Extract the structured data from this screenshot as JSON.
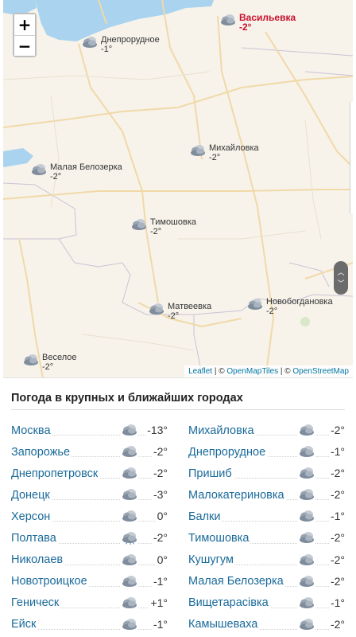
{
  "map": {
    "zoom_in": "+",
    "zoom_out": "−",
    "markers": [
      {
        "name": "Васильевка",
        "temp": "-2°",
        "icon": "cloud-icon",
        "active": true
      },
      {
        "name": "Днепрорудное",
        "temp": "-1°",
        "icon": "cloud-icon",
        "active": false
      },
      {
        "name": "Михайловка",
        "temp": "-2°",
        "icon": "cloud-icon",
        "active": false
      },
      {
        "name": "Малая Белозерка",
        "temp": "-2°",
        "icon": "cloud-icon",
        "active": false
      },
      {
        "name": "Тимошовка",
        "temp": "-2°",
        "icon": "cloud-icon",
        "active": false
      },
      {
        "name": "Новобогдановка",
        "temp": "-2°",
        "icon": "cloud-icon",
        "active": false
      },
      {
        "name": "Матвеевка",
        "temp": "-2°",
        "icon": "cloud-icon",
        "active": false
      },
      {
        "name": "Веселое",
        "temp": "-2°",
        "icon": "cloud-icon",
        "active": false
      }
    ],
    "attribution": {
      "leaflet": "Leaflet",
      "sep1": " | © ",
      "openmaptiles": "OpenMapTiles",
      "sep2": " | © ",
      "openstreetmap": "OpenStreetMap"
    }
  },
  "cities": {
    "title": "Погода в крупных и ближайших городах",
    "left": [
      {
        "name": "Москва",
        "temp": "-13°",
        "icon": "cloud-icon"
      },
      {
        "name": "Запорожье",
        "temp": "-2°",
        "icon": "cloud-icon"
      },
      {
        "name": "Днепропетровск",
        "temp": "-2°",
        "icon": "cloud-icon"
      },
      {
        "name": "Донецк",
        "temp": "-3°",
        "icon": "cloud-icon"
      },
      {
        "name": "Херсон",
        "temp": "0°",
        "icon": "cloud-icon"
      },
      {
        "name": "Полтава",
        "temp": "-2°",
        "icon": "snow-cloud-icon"
      },
      {
        "name": "Николаев",
        "temp": "0°",
        "icon": "cloud-icon"
      },
      {
        "name": "Новотроицкое",
        "temp": "-1°",
        "icon": "cloud-icon"
      },
      {
        "name": "Геническ",
        "temp": "+1°",
        "icon": "cloud-icon"
      },
      {
        "name": "Ейск",
        "temp": "-1°",
        "icon": "cloud-icon"
      }
    ],
    "right": [
      {
        "name": "Михайловка",
        "temp": "-2°",
        "icon": "cloud-icon"
      },
      {
        "name": "Днепрорудное",
        "temp": "-1°",
        "icon": "cloud-icon"
      },
      {
        "name": "Пришиб",
        "temp": "-2°",
        "icon": "cloud-icon"
      },
      {
        "name": "Малокатериновка",
        "temp": "-2°",
        "icon": "cloud-icon"
      },
      {
        "name": "Балки",
        "temp": "-1°",
        "icon": "cloud-icon"
      },
      {
        "name": "Тимошовка",
        "temp": "-2°",
        "icon": "cloud-icon"
      },
      {
        "name": "Кушугум",
        "temp": "-2°",
        "icon": "cloud-icon"
      },
      {
        "name": "Малая Белозерка",
        "temp": "-2°",
        "icon": "cloud-icon"
      },
      {
        "name": "Вищетарасівка",
        "temp": "-1°",
        "icon": "cloud-icon"
      },
      {
        "name": "Камышеваха",
        "temp": "-2°",
        "icon": "cloud-icon"
      }
    ]
  }
}
